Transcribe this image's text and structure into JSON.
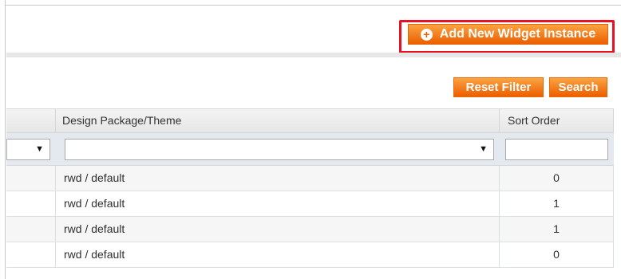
{
  "header": {
    "add_button_label": "Add New Widget Instance",
    "add_icon": "plus-circle-icon"
  },
  "filters": {
    "reset_label": "Reset Filter",
    "search_label": "Search"
  },
  "grid": {
    "columns": [
      "Design Package/Theme",
      "Sort Order"
    ],
    "rows": [
      {
        "theme": "rwd / default",
        "sort_order": "0"
      },
      {
        "theme": "rwd / default",
        "sort_order": "1"
      },
      {
        "theme": "rwd / default",
        "sort_order": "1"
      },
      {
        "theme": "rwd / default",
        "sort_order": "0"
      }
    ]
  },
  "colors": {
    "button_orange": "#eb5e00",
    "highlight_red": "#e81123",
    "filter_row_bg": "#e3e9ef"
  }
}
